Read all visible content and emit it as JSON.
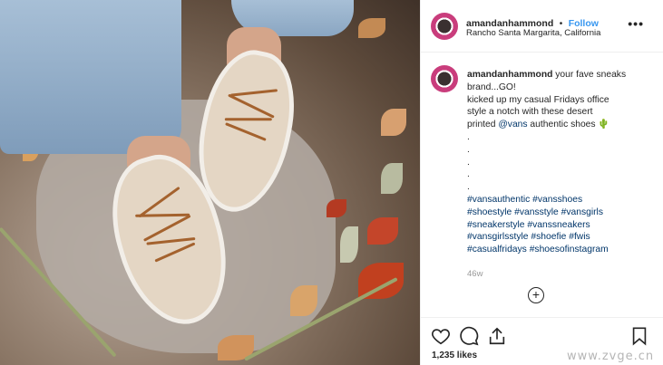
{
  "post": {
    "user": {
      "username": "amandanhammond",
      "separator": "•",
      "follow_label": "Follow",
      "location": "Rancho Santa Margarita, California"
    },
    "more_label": "•••",
    "caption": {
      "username": "amandanhammond",
      "line1_text": " your fave sneaks",
      "line2": "brand...GO!",
      "line3": "kicked up my casual Fridays office",
      "line4": "style a notch with these desert",
      "line5_prefix": "printed ",
      "line5_mention": "@vans",
      "line5_suffix": " authentic shoes 🌵",
      "dots": [
        ".",
        ".",
        ".",
        ".",
        "."
      ],
      "hashtag_lines": [
        [
          "#vansauthentic",
          "#vansshoes"
        ],
        [
          "#shoestyle",
          "#vansstyle",
          "#vansgirls"
        ],
        [
          "#sneakerstyle",
          "#vanssneakers"
        ],
        [
          "#vansgirlsstyle",
          "#shoefie",
          "#fwis"
        ],
        [
          "#casualfridays",
          "#shoesofinstagram"
        ]
      ]
    },
    "time_ago": "46w",
    "load_more_label": "+",
    "likes": "1,235 likes",
    "icons": [
      "heart-icon",
      "comment-icon",
      "share-icon",
      "bookmark-icon"
    ]
  },
  "watermark": "www.zvge.cn"
}
